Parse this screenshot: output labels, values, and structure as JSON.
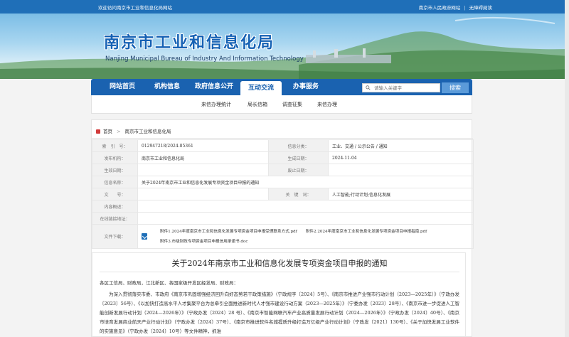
{
  "topbar": {
    "welcome": "欢迎访问南京市工业和信息化局网站",
    "links": [
      "南京市人民政府网站",
      "无障碍阅读"
    ]
  },
  "banner": {
    "title_cn": "南京市工业和信息化局",
    "title_en": "Nanjing Municipal Bureau of Industry And Information Technology"
  },
  "nav": {
    "items": [
      "网站首页",
      "机构信息",
      "政府信息公开",
      "互动交流",
      "办事服务"
    ],
    "active": "互动交流"
  },
  "search": {
    "placeholder": "请输入关键字",
    "button": "搜索"
  },
  "subnav": {
    "items": [
      "来信办理统计",
      "局长信箱",
      "调查征集",
      "来信办理"
    ]
  },
  "breadcrumb": {
    "home": "首页",
    "current": "南京市工业和信息化局"
  },
  "meta": {
    "index_label": "索　引　号：",
    "index_value": "012947218/2024-85361",
    "category_label": "信息分类：",
    "category_value": "工业、交通 / 公示公告 / 通知",
    "issuer_label": "发布机构：",
    "issuer_value": "南京市工业和信息化局",
    "date_label": "生成日期：",
    "date_value": "2024-11-04",
    "effective_label": "生效日期：",
    "effective_value": "",
    "abolish_label": "废止日期：",
    "abolish_value": "",
    "name_label": "信息名称：",
    "name_value": "关于2024年南京市工业和信息化发展专项资金项目申报的通知",
    "docno_label": "文　　号：",
    "docno_value": "",
    "keywords_label": "关　键　词：",
    "keywords_value": "人工智能;行动计划;信息化发展",
    "summary_label": "内容概述：",
    "summary_value": "",
    "online_label": "在线链接地址：",
    "online_value": "",
    "download_label": "文件下载：",
    "attachments": [
      "附件1.2024年度南京市工业和信息化发展专项资金项目申报受理联系方式.pdf",
      "附件2.2024年度南京市工业和信息化发展专项资金项目申报指南.pdf",
      "附件3.市级财政专项资金项目申报信用承诺书.doc"
    ]
  },
  "doc": {
    "title": "关于2024年南京市工业和信息化发展专项资金项目申报的通知",
    "greeting": "各区工信局、财政局，江北新区、各国家级开发区经发局、财政局：",
    "body": "为深入贯彻落实市委、市政府《南京市巩固增强经济回升向好态势若干政策措施》（宁政规字〔2024〕5号）、《南京市推进产业强市行动计划（2023—2025年）》（宁政办发〔2023〕56号）、《以加快打造高水平人才集聚平台为总牵引全面推进新时代人才强市建设行动方案（2023—2025年）》（宁委办发〔2023〕28号）、《南京市进一步促进人工智能创新发展行动计划（2024—2026年）》（宁政办发〔2024〕28 号）、《南京市智能网联汽车产业高质量发展行动计划（2024—2026年）》（宁政办发〔2024〕40号）、《南京市培育发展商业航天产业行动计划》（宁政办发〔2024〕37号）、《南京市推进软件名城提质升级打造万亿级产业行动计划》（宁政发〔2021〕130号）、《关于加快发展工业软件的实施意见》（宁政办发〔2024〕10号）等文件精神，抓准"
  }
}
